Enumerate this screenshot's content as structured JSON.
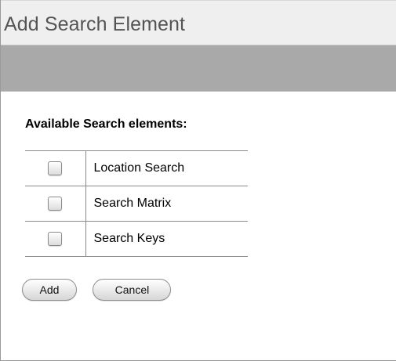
{
  "dialog": {
    "title": "Add Search Element"
  },
  "section": {
    "heading": "Available Search elements:"
  },
  "elements": [
    {
      "label": "Location Search",
      "checked": false
    },
    {
      "label": "Search Matrix",
      "checked": false
    },
    {
      "label": "Search Keys",
      "checked": false
    }
  ],
  "buttons": {
    "add_label": "Add",
    "cancel_label": "Cancel"
  }
}
